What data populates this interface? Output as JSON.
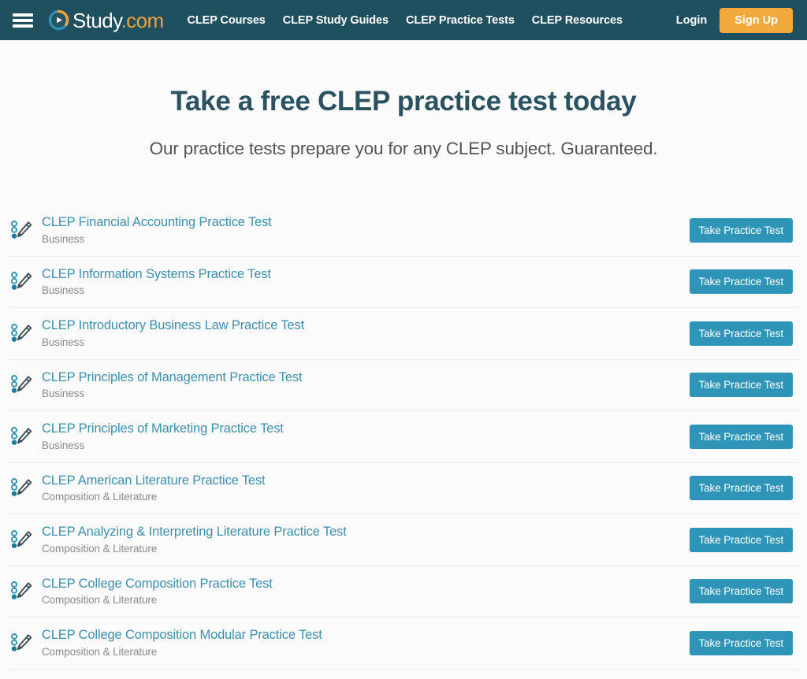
{
  "header": {
    "menu_icon": "hamburger-menu-icon",
    "logo_icon": "study-play-circle-icon",
    "logo_text": "Study",
    "logo_suffix": ".com",
    "logo_domain": "com",
    "nav_items": [
      {
        "label": "CLEP Courses"
      },
      {
        "label": "CLEP Study Guides"
      },
      {
        "label": "CLEP Practice Tests"
      },
      {
        "label": "CLEP Resources"
      }
    ],
    "login_label": "Login",
    "signup_label": "Sign Up",
    "background_color": "#1f505f",
    "signup_color": "#f2a93c"
  },
  "hero": {
    "title": "Take a free CLEP practice test today",
    "subtitle": "Our practice tests prepare you for any CLEP subject. Guaranteed."
  },
  "list": {
    "button_label": "Take Practice Test",
    "item_icon": "practice-test-pencil-bubbles-icon",
    "accent_color": "#2e95b8",
    "link_color": "#3d8fae",
    "items": [
      {
        "title": "CLEP Financial Accounting Practice Test",
        "subject": "Business"
      },
      {
        "title": "CLEP Information Systems Practice Test",
        "subject": "Business"
      },
      {
        "title": "CLEP Introductory Business Law Practice Test",
        "subject": "Business"
      },
      {
        "title": "CLEP Principles of Management Practice Test",
        "subject": "Business"
      },
      {
        "title": "CLEP Principles of Marketing Practice Test",
        "subject": "Business"
      },
      {
        "title": "CLEP American Literature Practice Test",
        "subject": "Composition & Literature"
      },
      {
        "title": "CLEP Analyzing & Interpreting Literature Practice Test",
        "subject": "Composition & Literature"
      },
      {
        "title": "CLEP College Composition Practice Test",
        "subject": "Composition & Literature"
      },
      {
        "title": "CLEP College Composition Modular Practice Test",
        "subject": "Composition & Literature"
      }
    ]
  }
}
